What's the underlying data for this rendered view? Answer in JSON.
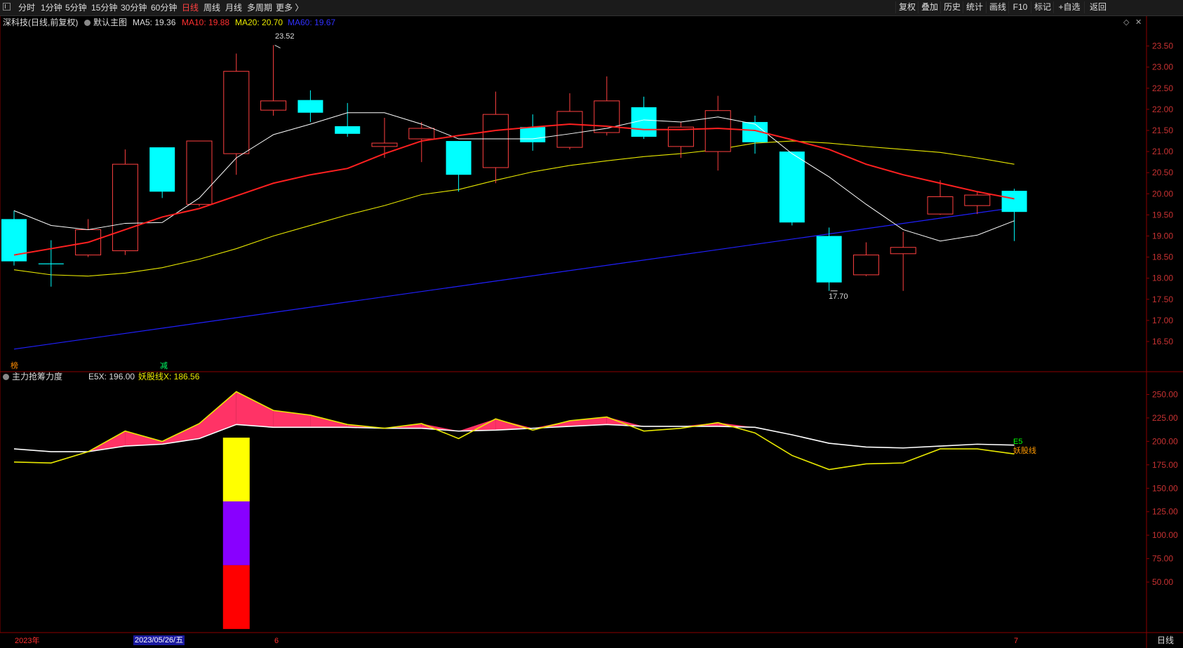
{
  "toolbar": {
    "periods": [
      "分时",
      "1分钟",
      "5分钟",
      "15分钟",
      "30分钟",
      "60分钟",
      "日线",
      "周线",
      "月线",
      "多周期",
      "更多 〉"
    ],
    "active_index": 6,
    "right_buttons": [
      "复权",
      "叠加",
      "历史",
      "统计",
      "画线",
      "F10",
      "标记",
      "+自选",
      "返回"
    ]
  },
  "main_legend": {
    "stock_name": "深科技",
    "mode": "(日线,前复权)",
    "indicator_name": "默认主图",
    "ma5": "MA5: 19.36",
    "ma10": "MA10: 19.88",
    "ma20": "MA20: 20.70",
    "ma60": "MA60: 19.67",
    "high_label": "23.52",
    "low_label": "17.70",
    "marker_a": "榜",
    "marker_b": "减"
  },
  "sub_legend": {
    "indicator_name": "主力抢筹力度",
    "e5x": "E5X: 196.00",
    "yao_x": "妖股线X: 186.56",
    "e5_tag": "E5",
    "yao_tag": "妖股线"
  },
  "bottom_axis": {
    "year_label": "2023年",
    "cursor_date": "2023/05/26/五",
    "month_6": "6",
    "month_7": "7",
    "period_label": "日线"
  },
  "colors": {
    "up": "#ff4040",
    "down": "#00ffff",
    "ma5": "#ffffff",
    "ma10": "#ff2020",
    "ma20": "#e8e800",
    "ma60": "#2020ff",
    "fill": "#ff3366"
  },
  "chart_data": [
    {
      "type": "candlestick",
      "yticks": [
        16.5,
        17.0,
        17.5,
        18.0,
        18.5,
        19.0,
        19.5,
        20.0,
        20.5,
        21.0,
        21.5,
        22.0,
        22.5,
        23.0,
        23.5
      ],
      "ylim": [
        16.2,
        23.7
      ],
      "candles": [
        {
          "o": 19.4,
          "c": 18.4,
          "h": 19.6,
          "l": 18.3
        },
        {
          "o": 18.35,
          "c": 18.33,
          "h": 18.9,
          "l": 17.8
        },
        {
          "o": 18.55,
          "c": 19.15,
          "h": 19.4,
          "l": 18.5
        },
        {
          "o": 18.65,
          "c": 20.7,
          "h": 21.05,
          "l": 18.55
        },
        {
          "o": 21.1,
          "c": 20.05,
          "h": 21.1,
          "l": 19.9
        },
        {
          "o": 19.75,
          "c": 21.25,
          "h": 21.25,
          "l": 19.7
        },
        {
          "o": 20.95,
          "c": 22.9,
          "h": 23.32,
          "l": 20.45
        },
        {
          "o": 21.98,
          "c": 22.2,
          "h": 23.52,
          "l": 21.85
        },
        {
          "o": 22.22,
          "c": 21.92,
          "h": 22.45,
          "l": 21.7
        },
        {
          "o": 21.6,
          "c": 21.42,
          "h": 22.15,
          "l": 21.35
        },
        {
          "o": 21.12,
          "c": 21.2,
          "h": 21.8,
          "l": 20.85
        },
        {
          "o": 21.3,
          "c": 21.55,
          "h": 21.7,
          "l": 20.75
        },
        {
          "o": 21.25,
          "c": 20.45,
          "h": 21.25,
          "l": 20.05
        },
        {
          "o": 20.62,
          "c": 21.88,
          "h": 22.42,
          "l": 20.25
        },
        {
          "o": 21.58,
          "c": 21.22,
          "h": 21.88,
          "l": 21.02
        },
        {
          "o": 21.1,
          "c": 21.95,
          "h": 22.38,
          "l": 21.05
        },
        {
          "o": 21.45,
          "c": 22.2,
          "h": 22.78,
          "l": 21.38
        },
        {
          "o": 22.05,
          "c": 21.35,
          "h": 22.3,
          "l": 21.3
        },
        {
          "o": 21.12,
          "c": 21.58,
          "h": 21.7,
          "l": 20.85
        },
        {
          "o": 21.0,
          "c": 21.97,
          "h": 22.32,
          "l": 20.55
        },
        {
          "o": 21.7,
          "c": 21.22,
          "h": 21.85,
          "l": 20.95
        },
        {
          "o": 21.0,
          "c": 19.32,
          "h": 21.0,
          "l": 19.25
        },
        {
          "o": 19.0,
          "c": 17.9,
          "h": 19.2,
          "l": 17.7
        },
        {
          "o": 18.08,
          "c": 18.55,
          "h": 18.85,
          "l": 18.05
        },
        {
          "o": 18.58,
          "c": 18.73,
          "h": 19.1,
          "l": 17.7
        },
        {
          "o": 19.52,
          "c": 19.93,
          "h": 20.32,
          "l": 19.5
        },
        {
          "o": 19.72,
          "c": 19.97,
          "h": 20.05,
          "l": 19.52
        },
        {
          "o": 20.07,
          "c": 19.57,
          "h": 20.12,
          "l": 18.88
        }
      ],
      "ma5": [
        19.6,
        19.25,
        19.15,
        19.3,
        19.32,
        19.9,
        20.85,
        21.4,
        21.65,
        21.92,
        21.92,
        21.65,
        21.3,
        21.3,
        21.3,
        21.42,
        21.55,
        21.75,
        21.7,
        21.82,
        21.65,
        20.95,
        20.4,
        19.75,
        19.15,
        18.88,
        19.02,
        19.36
      ],
      "ma10": [
        18.55,
        18.7,
        18.85,
        19.15,
        19.45,
        19.65,
        19.95,
        20.25,
        20.45,
        20.6,
        20.95,
        21.25,
        21.38,
        21.5,
        21.58,
        21.65,
        21.6,
        21.52,
        21.52,
        21.55,
        21.5,
        21.28,
        21.05,
        20.7,
        20.45,
        20.25,
        20.05,
        19.88
      ],
      "ma20": [
        18.2,
        18.08,
        18.05,
        18.12,
        18.25,
        18.45,
        18.7,
        19.0,
        19.25,
        19.5,
        19.72,
        19.98,
        20.1,
        20.32,
        20.52,
        20.67,
        20.78,
        20.88,
        20.95,
        21.05,
        21.2,
        21.25,
        21.2,
        21.12,
        21.05,
        20.98,
        20.85,
        20.7
      ],
      "ma60": {
        "start": 16.32,
        "end": 19.67
      }
    },
    {
      "type": "line",
      "name": "主力抢筹力度",
      "yticks": [
        50,
        75,
        100,
        125,
        150,
        175,
        200,
        225,
        250
      ],
      "ylim": [
        10,
        270
      ],
      "e5": [
        192,
        189,
        189,
        195,
        197,
        203,
        218,
        215,
        215,
        215,
        214,
        214,
        211,
        212,
        214,
        216,
        218,
        216,
        216,
        216,
        215,
        207,
        198,
        194,
        193,
        195,
        197,
        196
      ],
      "yao": [
        178,
        177,
        189,
        211,
        200,
        219,
        253,
        233,
        228,
        218,
        214,
        219,
        203,
        224,
        212,
        222,
        226,
        211,
        214,
        220,
        209,
        185,
        170,
        176,
        177,
        192,
        192,
        186.56
      ],
      "bar_segments": [
        {
          "from": 204,
          "to": 136,
          "color": "#ffff00"
        },
        {
          "from": 136,
          "to": 68,
          "color": "#8800ff"
        },
        {
          "from": 68,
          "to": 0,
          "color": "#ff0000"
        }
      ]
    }
  ]
}
